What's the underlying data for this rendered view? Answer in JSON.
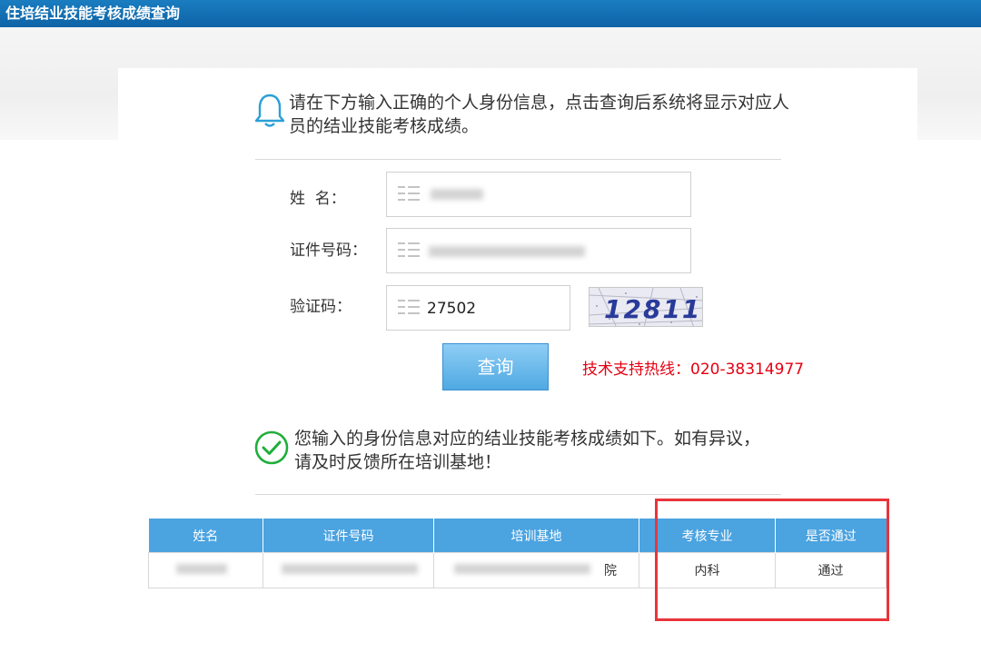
{
  "header": {
    "title": "住培结业技能考核成绩查询"
  },
  "intro": {
    "text": "请在下方输入正确的个人身份信息，点击查询后系统将显示对应人员的结业技能考核成绩。"
  },
  "form": {
    "name_label": "姓  名：",
    "id_label": "证件号码：",
    "captcha_label": "验证码：",
    "captcha_value": "27502",
    "captcha_image_text": "12811",
    "query_button": "查询",
    "hotline": "技术支持热线：020-38314977"
  },
  "result": {
    "message": "您输入的身份信息对应的结业技能考核成绩如下。如有异议，请及时反馈所在培训基地！",
    "columns": [
      "姓名",
      "证件号码",
      "培训基地",
      "考核专业",
      "是否通过"
    ],
    "row": {
      "base_suffix": "院",
      "major": "内科",
      "passed": "通过"
    }
  },
  "colors": {
    "header": "#0e63a6",
    "table_header": "#4ba3e0",
    "hotline": "#e60012",
    "highlight": "#e8353b"
  }
}
